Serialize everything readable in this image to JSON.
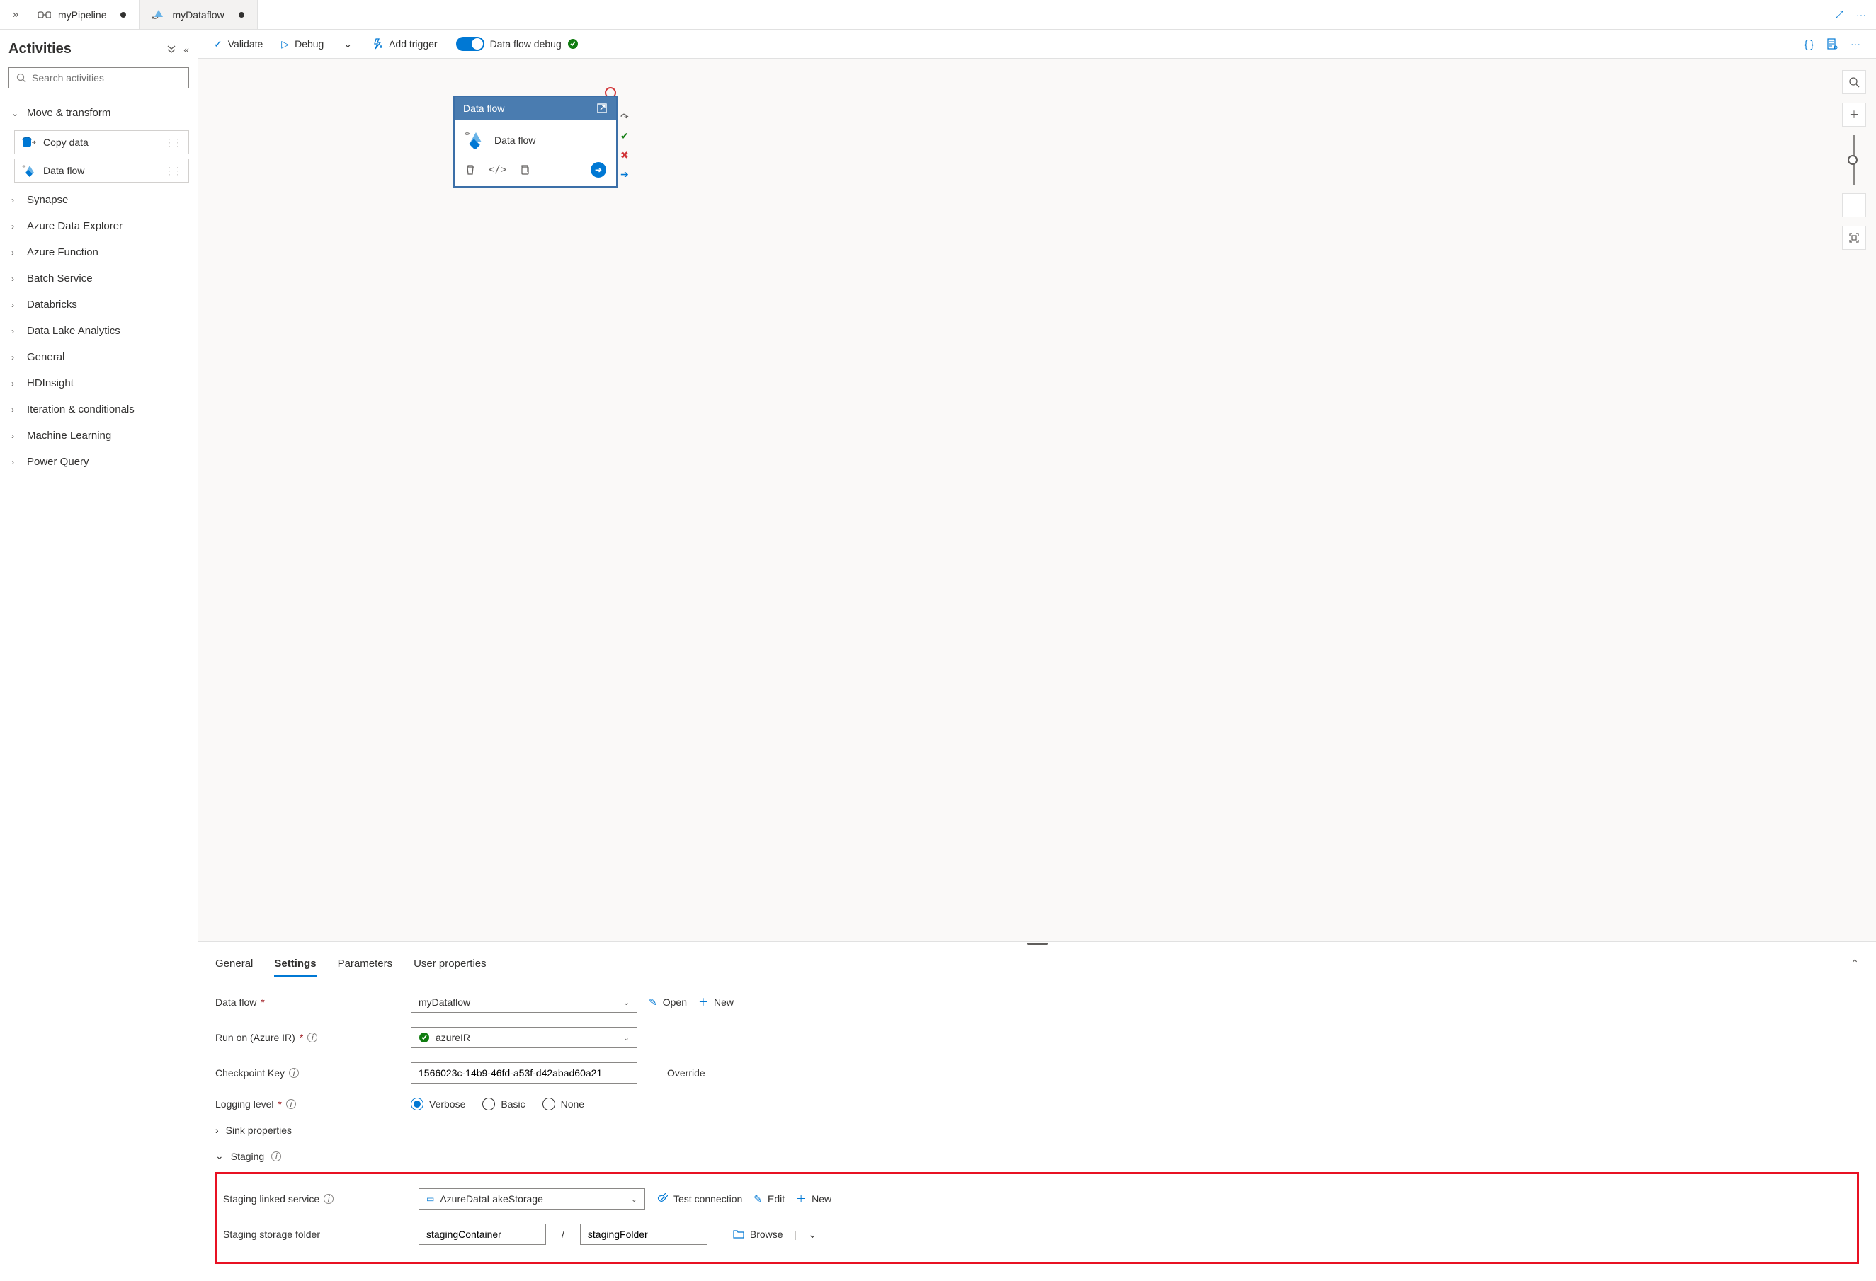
{
  "tabs": [
    {
      "label": "myPipeline",
      "active": true
    },
    {
      "label": "myDataflow",
      "active": false
    }
  ],
  "sidebar": {
    "title": "Activities",
    "search_placeholder": "Search activities",
    "expanded_category": "Move & transform",
    "activities": [
      {
        "label": "Copy data"
      },
      {
        "label": "Data flow"
      }
    ],
    "categories": [
      "Synapse",
      "Azure Data Explorer",
      "Azure Function",
      "Batch Service",
      "Databricks",
      "Data Lake Analytics",
      "General",
      "HDInsight",
      "Iteration & conditionals",
      "Machine Learning",
      "Power Query"
    ]
  },
  "toolbar": {
    "validate": "Validate",
    "debug": "Debug",
    "add_trigger": "Add trigger",
    "flow_debug": "Data flow debug"
  },
  "canvas": {
    "activity_type": "Data flow",
    "activity_name": "Data flow"
  },
  "panel": {
    "tabs": [
      "General",
      "Settings",
      "Parameters",
      "User properties"
    ],
    "active_tab": "Settings",
    "labels": {
      "data_flow": "Data flow",
      "run_on": "Run on (Azure IR)",
      "checkpoint": "Checkpoint Key",
      "logging": "Logging level",
      "sink": "Sink properties",
      "staging": "Staging",
      "staging_service": "Staging linked service",
      "staging_folder": "Staging storage folder"
    },
    "values": {
      "data_flow": "myDataflow",
      "run_on": "azureIR",
      "checkpoint": "1566023c-14b9-46fd-a53f-d42abad60a21",
      "override": "Override",
      "logging_options": [
        "Verbose",
        "Basic",
        "None"
      ],
      "logging_selected": "Verbose",
      "staging_service": "AzureDataLakeStorage",
      "staging_container": "stagingContainer",
      "staging_folder": "stagingFolder"
    },
    "actions": {
      "open": "Open",
      "new": "New",
      "test_connection": "Test connection",
      "edit": "Edit",
      "browse": "Browse"
    }
  }
}
